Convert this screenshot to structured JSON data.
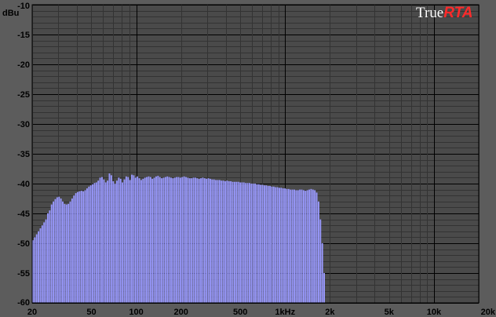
{
  "app": {
    "logo_part1": "True",
    "logo_part2": "RTA",
    "logo_colors": {
      "part1": "#ffffff",
      "part2": "#ff2a2a"
    }
  },
  "colors": {
    "background": "#5c5c5c",
    "plot_background": "#4a4a4a",
    "grid_major": "#000000",
    "grid_minor": "#333333",
    "bars": "#9999ff",
    "bar_edge": "#b0b0ff"
  },
  "chart_data": {
    "type": "bar",
    "title": "",
    "xlabel": "",
    "ylabel": "dBu",
    "xscale": "log",
    "xlim": [
      20,
      20000
    ],
    "ylim": [
      -60,
      -10
    ],
    "grid": true,
    "y_ticks": [
      "-10",
      "-15",
      "-20",
      "-25",
      "-30",
      "-35",
      "-40",
      "-45",
      "-50",
      "-55",
      "-60"
    ],
    "y_tick_values": [
      -10,
      -15,
      -20,
      -25,
      -30,
      -35,
      -40,
      -45,
      -50,
      -55,
      -60
    ],
    "x_ticks": [
      "20",
      "50",
      "100",
      "200",
      "500",
      "1kHz",
      "2k",
      "5k",
      "10k",
      "20k"
    ],
    "x_tick_values": [
      20,
      50,
      100,
      200,
      500,
      1000,
      2000,
      5000,
      10000,
      20000
    ],
    "series": [
      {
        "bands_per_octave": 24,
        "values": [
          -49.5,
          -49,
          -48.5,
          -48,
          -47.5,
          -47,
          -46.5,
          -46,
          -45,
          -44.5,
          -43.5,
          -43,
          -42.6,
          -42.3,
          -42.2,
          -42.5,
          -43,
          -43.4,
          -43.5,
          -43.4,
          -43,
          -42.5,
          -42,
          -41.6,
          -41.4,
          -41.3,
          -41.2,
          -41.3,
          -41.1,
          -40.8,
          -40.5,
          -40.3,
          -40.1,
          -39.9,
          -39.8,
          -39.5,
          -39.0,
          -38.9,
          -39.3,
          -39.8,
          -39.5,
          -38.3,
          -38.6,
          -39.6,
          -40.0,
          -39.5,
          -39.0,
          -39.2,
          -39.8,
          -39.3,
          -38.8,
          -38.9,
          -39.4,
          -38.5,
          -38.6,
          -39.0,
          -38.8,
          -39.1,
          -39.4,
          -39.2,
          -39.0,
          -38.9,
          -38.8,
          -38.9,
          -39.2,
          -39.0,
          -38.8,
          -38.7,
          -38.9,
          -39.1,
          -39.0,
          -38.9,
          -38.8,
          -38.9,
          -39.0,
          -39.1,
          -39.0,
          -38.9,
          -38.9,
          -39.0,
          -38.9,
          -38.8,
          -38.9,
          -39.0,
          -39.1,
          -39.1,
          -39.0,
          -39.0,
          -39.1,
          -39.2,
          -39.1,
          -39.0,
          -39.1,
          -39.2,
          -39.1,
          -39.2,
          -39.3,
          -39.3,
          -39.4,
          -39.4,
          -39.4,
          -39.5,
          -39.5,
          -39.6,
          -39.5,
          -39.6,
          -39.6,
          -39.7,
          -39.7,
          -39.7,
          -39.7,
          -39.8,
          -39.8,
          -39.8,
          -39.9,
          -39.9,
          -39.9,
          -40.0,
          -40.0,
          -40.0,
          -40.1,
          -40.1,
          -40.2,
          -40.2,
          -40.3,
          -40.3,
          -40.4,
          -40.4,
          -40.5,
          -40.5,
          -40.6,
          -40.6,
          -40.7,
          -40.7,
          -40.8,
          -40.8,
          -40.9,
          -40.9,
          -41.0,
          -41.0,
          -41.0,
          -41.1,
          -41.1,
          -41.0,
          -41.0,
          -41.1,
          -41.2,
          -41.1,
          -41.0,
          -40.9,
          -41.0,
          -41.1,
          -41.5,
          -43.0,
          -46.0,
          -50.0,
          -55.0,
          -60.0
        ]
      }
    ]
  }
}
